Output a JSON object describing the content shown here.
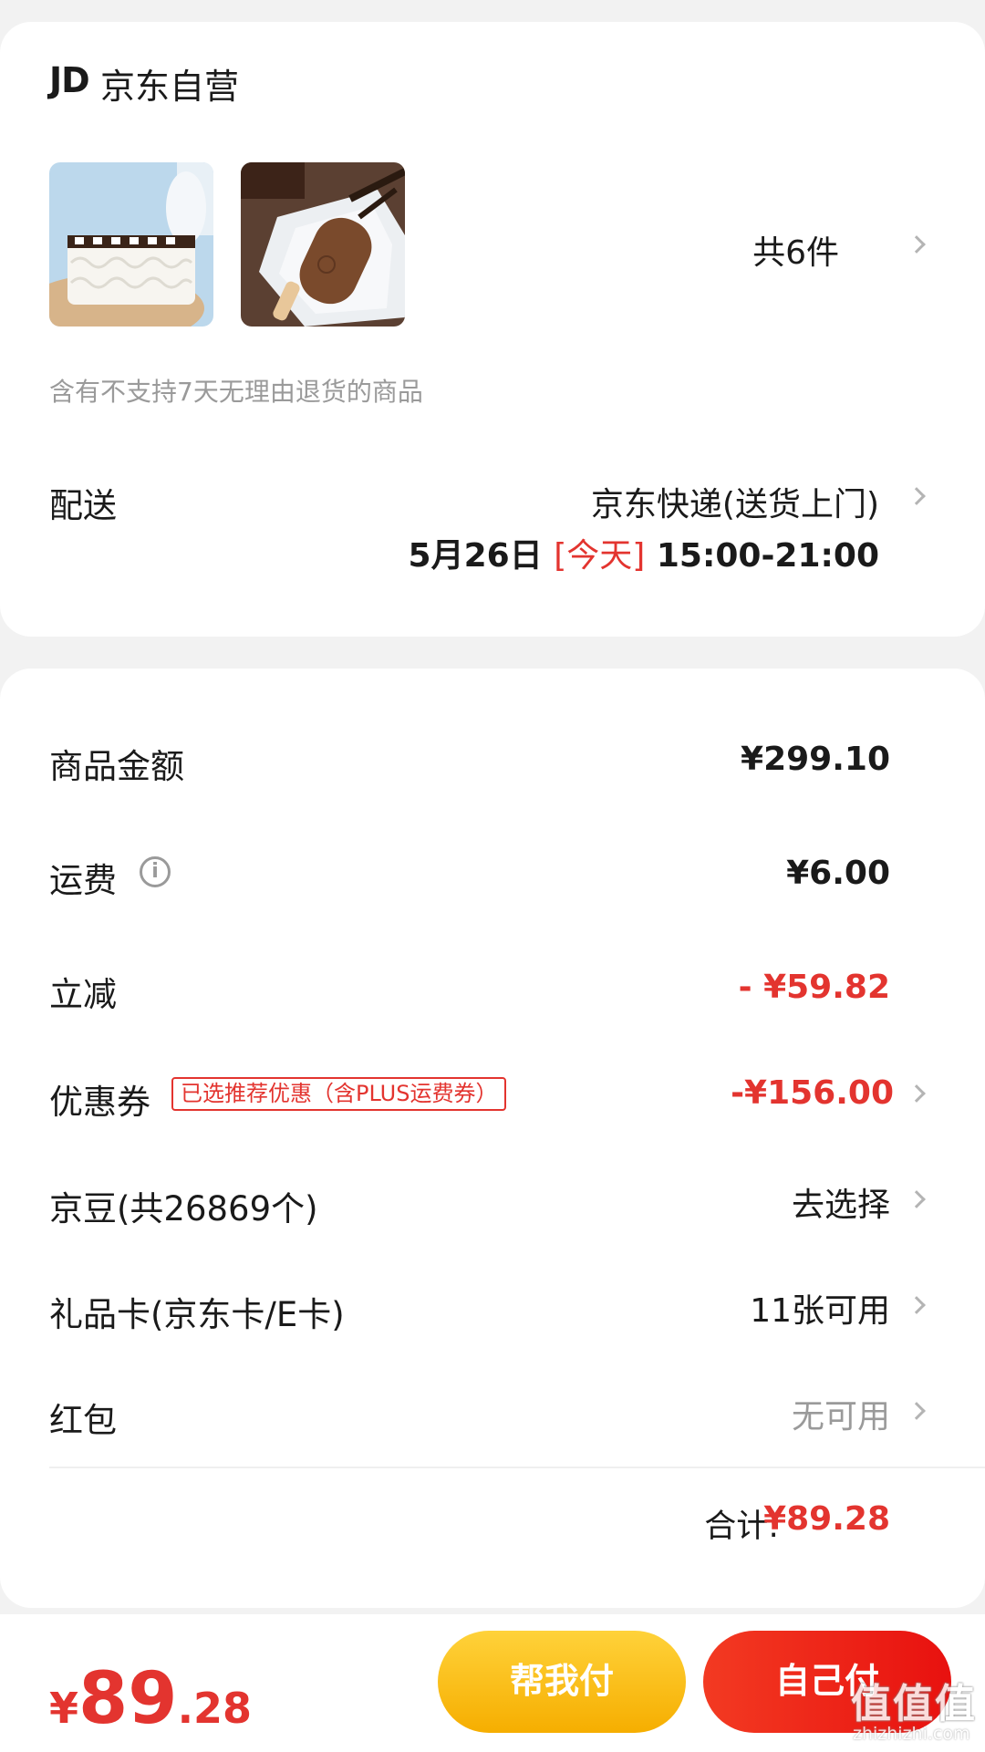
{
  "store": {
    "logo": "JD",
    "name": "京东自营"
  },
  "products": {
    "thumbnails": [
      {
        "icon": "milk-ice-cream-cake-image"
      },
      {
        "icon": "chocolate-ice-cream-bar-image"
      }
    ],
    "count_label": "共6件",
    "return_notice": "含有不支持7天无理由退货的商品"
  },
  "delivery": {
    "label": "配送",
    "method": "京东快递(送货上门)",
    "date": "5月26日 ",
    "today_tag": "[今天]",
    "time_range": " 15:00-21:00"
  },
  "summary": {
    "goods_amount": {
      "label": "商品金额",
      "value": "¥299.10"
    },
    "shipping": {
      "label": "运费",
      "value": "¥6.00"
    },
    "discount": {
      "label": "立减",
      "value": "- ¥59.82"
    },
    "coupon": {
      "label": "优惠券",
      "badge": "已选推荐优惠（含PLUS运费券）",
      "value": "-¥156.00"
    },
    "jingdou": {
      "label": "京豆(共26869个)",
      "value": "去选择"
    },
    "gift_card": {
      "label": "礼品卡(京东卡/E卡)",
      "value": "11张可用"
    },
    "red_packet": {
      "label": "红包",
      "value": "无可用"
    },
    "total_label": "合计:",
    "total_value": "¥89.28"
  },
  "bottom_bar": {
    "currency": "¥",
    "price_int": "89",
    "price_dec": ".28",
    "help_pay_label": "帮我付",
    "self_pay_label": "自己付"
  },
  "watermark": {
    "main": "值值值",
    "sub": "zhizhizhi.com"
  },
  "colors": {
    "accent_red": "#e3342f",
    "help_button": "#f6ae00",
    "self_button": "#e8110f"
  }
}
